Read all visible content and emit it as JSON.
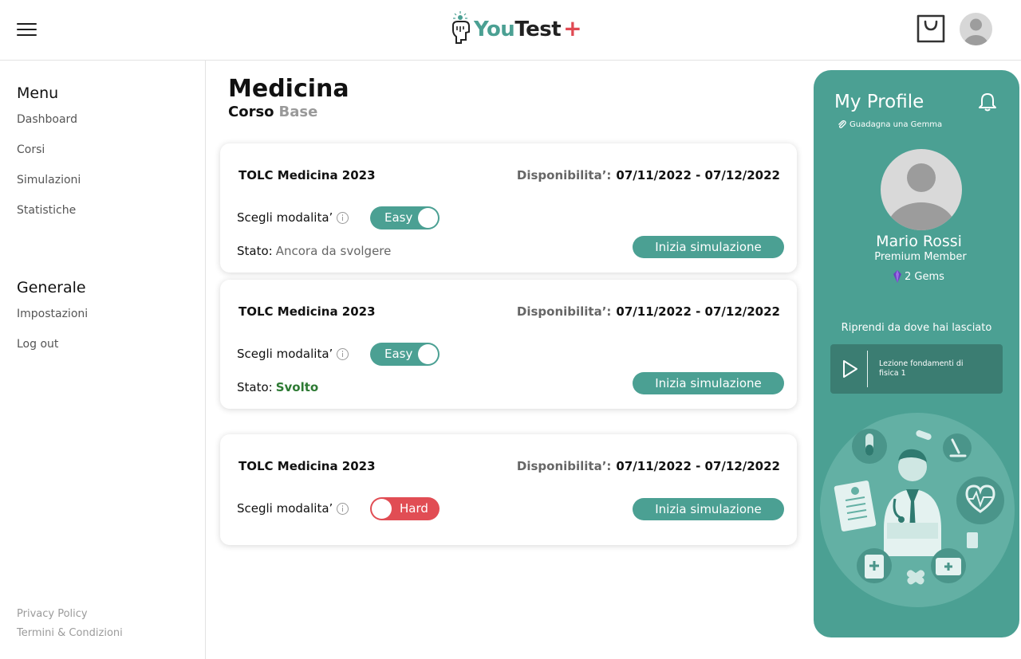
{
  "header": {
    "logo": {
      "you": "You",
      "test": "Test",
      "plus": "+"
    },
    "menu_icon": "hamburger-menu-icon",
    "cart_icon": "shopping-bag-icon",
    "avatar_icon": "user-avatar-icon"
  },
  "sidebar": {
    "menu_heading": "Menu",
    "menu_items": [
      {
        "label": "Dashboard"
      },
      {
        "label": "Corsi"
      },
      {
        "label": "Simulazioni"
      },
      {
        "label": "Statistiche"
      }
    ],
    "general_heading": "Generale",
    "general_items": [
      {
        "label": "Impostazioni"
      },
      {
        "label": "Log out"
      }
    ],
    "footer": {
      "privacy": "Privacy Policy",
      "terms": "Termini & Condizioni"
    }
  },
  "main": {
    "title": "Medicina",
    "subtitle_a": "Corso",
    "subtitle_b": "Base",
    "cards": [
      {
        "title": "TOLC Medicina 2023",
        "avail_label": "Disponibilita’:",
        "avail_value": "07/11/2022 - 07/12/2022",
        "mode_label": "Scegli modalita’",
        "mode_value": "Easy",
        "stato_label": "Stato:",
        "stato_value": "Ancora da svolgere",
        "button": "Inizia simulazione"
      },
      {
        "title": "TOLC Medicina 2023",
        "avail_label": "Disponibilita’:",
        "avail_value": "07/11/2022 - 07/12/2022",
        "mode_label": "Scegli modalita’",
        "mode_value": "Easy",
        "stato_label": "Stato:",
        "stato_value": "Svolto",
        "button": "Inizia simulazione"
      },
      {
        "title": "TOLC Medicina 2023",
        "avail_label": "Disponibilita’:",
        "avail_value": "07/11/2022 - 07/12/2022",
        "mode_label": "Scegli modalita’",
        "mode_value": "Hard",
        "button": "Inizia simulazione"
      }
    ]
  },
  "profile": {
    "title": "My Profile",
    "gem_link": "Guadagna una Gemma",
    "name": "Mario Rossi",
    "role": "Premium Member",
    "gems": "2 Gems",
    "resume_title": "Riprendi da dove hai lasciato",
    "resume_lesson": "Lezione fondamenti di fisica 1"
  },
  "colors": {
    "accent": "#4ba093",
    "hard": "#e14d54",
    "done": "#2d7a33"
  }
}
